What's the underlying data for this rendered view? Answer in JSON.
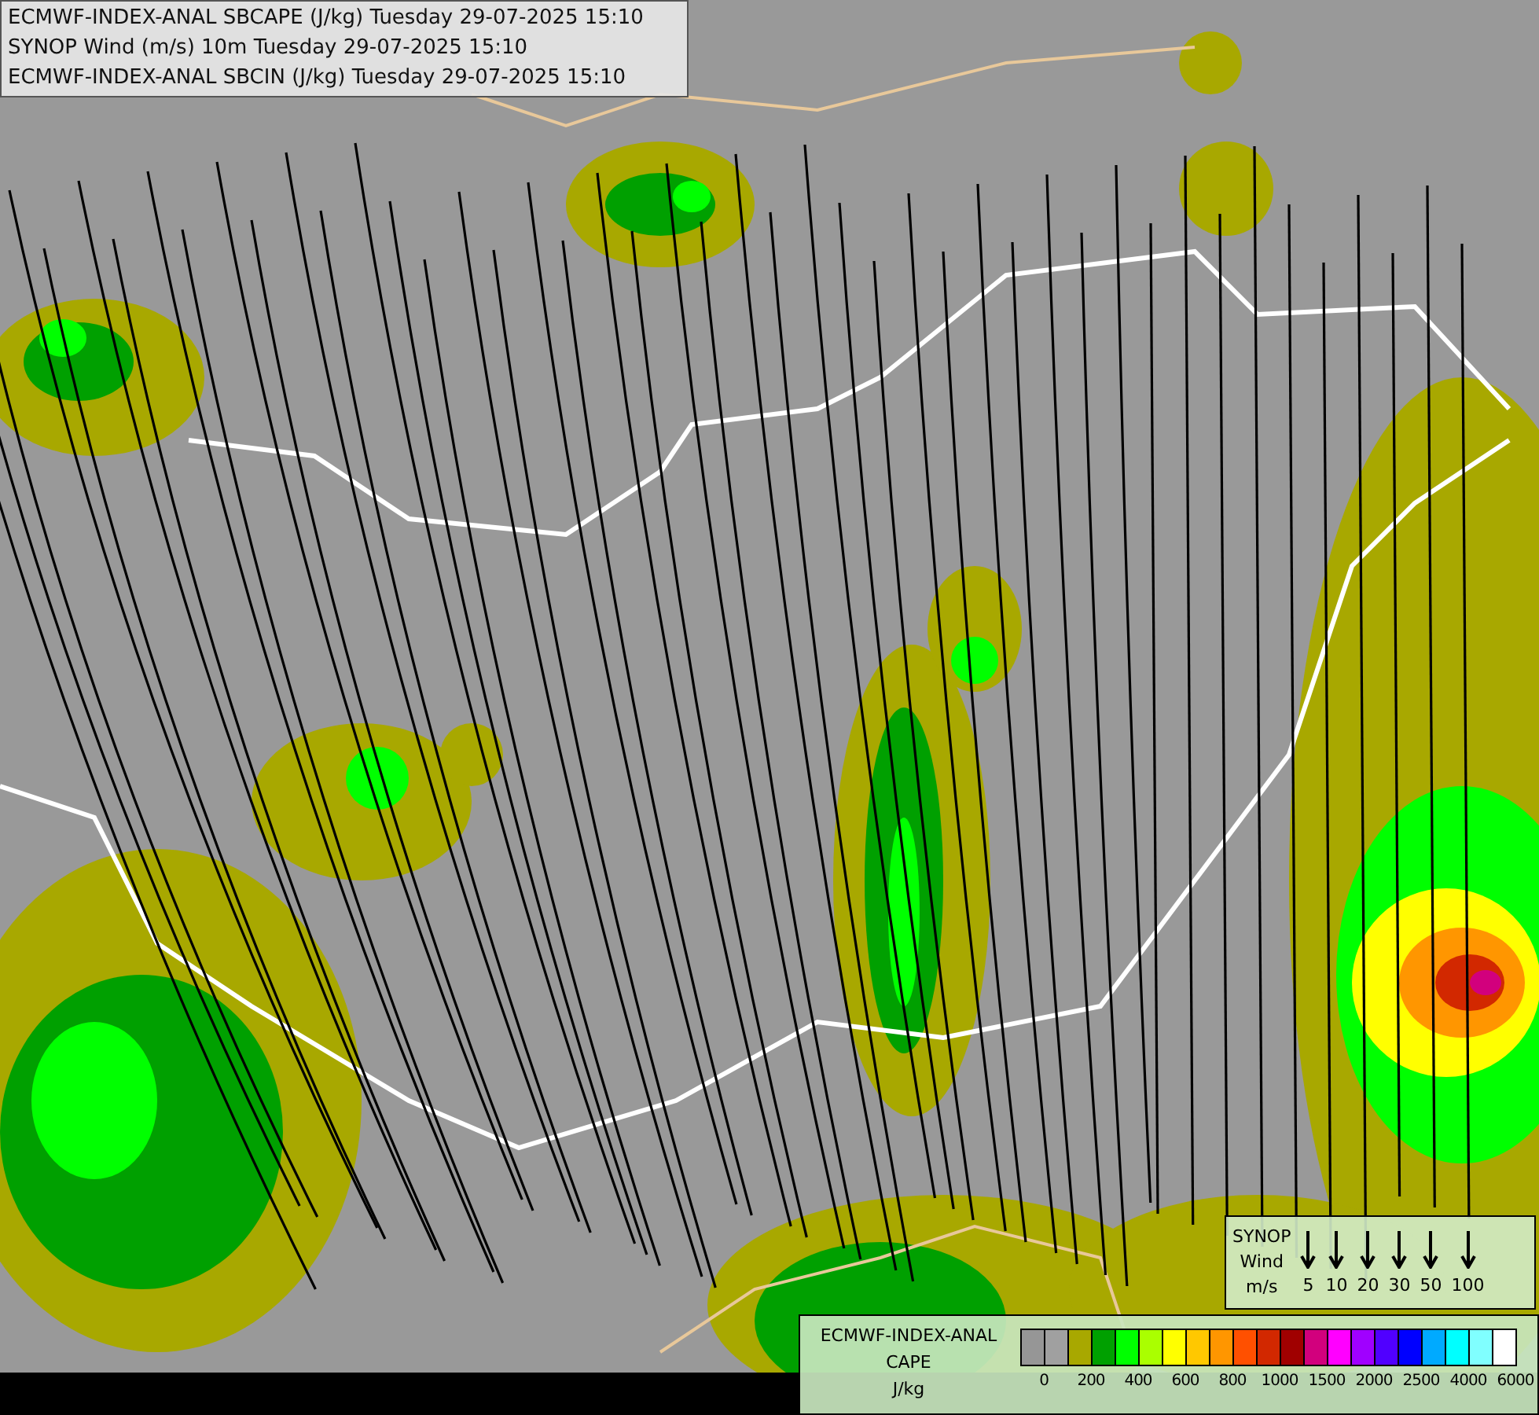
{
  "header": {
    "lines": [
      "ECMWF-INDEX-ANAL SBCAPE (J/kg) Tuesday 29-07-2025 15:10",
      "SYNOP Wind (m/s) 10m Tuesday 29-07-2025 15:10",
      "ECMWF-INDEX-ANAL SBCIN (J/kg) Tuesday 29-07-2025 15:10"
    ]
  },
  "wind_legend": {
    "title_lines": [
      "SYNOP",
      "Wind",
      "m/s"
    ],
    "speeds": [
      "5",
      "10",
      "20",
      "30",
      "50",
      "100"
    ]
  },
  "cape_legend": {
    "title_lines": [
      "ECMWF-INDEX-ANAL",
      "CAPE",
      "J/kg"
    ],
    "swatches": [
      {
        "color": "#969696"
      },
      {
        "color": "#a0a0a0"
      },
      {
        "color": "#a8a800"
      },
      {
        "color": "#00a000"
      },
      {
        "color": "#00ff00"
      },
      {
        "color": "#aaff00"
      },
      {
        "color": "#ffff00"
      },
      {
        "color": "#ffc800"
      },
      {
        "color": "#ff9600"
      },
      {
        "color": "#ff5000"
      },
      {
        "color": "#d22800"
      },
      {
        "color": "#a00000"
      },
      {
        "color": "#d2007d"
      },
      {
        "color": "#ff00ff"
      },
      {
        "color": "#a000ff"
      },
      {
        "color": "#5000ff"
      },
      {
        "color": "#0000ff"
      },
      {
        "color": "#00aaff"
      },
      {
        "color": "#00ffff"
      },
      {
        "color": "#80ffff"
      },
      {
        "color": "#ffffff"
      }
    ],
    "ticks": [
      "0",
      "200",
      "400",
      "600",
      "800",
      "1000",
      "1500",
      "2000",
      "2500",
      "4000",
      "6000"
    ]
  }
}
